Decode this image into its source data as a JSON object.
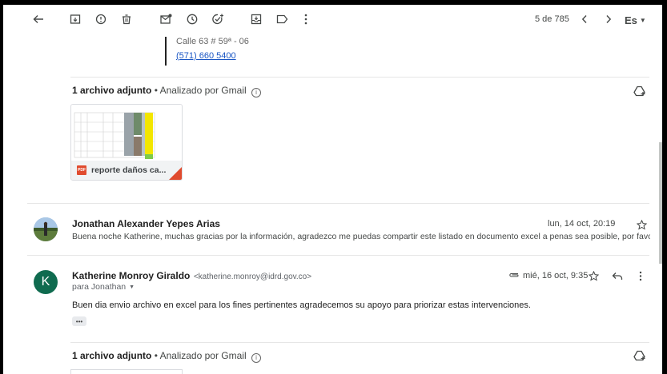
{
  "toolbar": {
    "pagination": "5 de 785",
    "language": "Es",
    "icons": [
      "back-arrow-icon",
      "archive-icon",
      "report-spam-icon",
      "trash-icon",
      "mark-unread-icon",
      "snooze-icon",
      "add-task-icon",
      "move-to-icon",
      "label-icon",
      "more-vert-icon",
      "prev-icon",
      "next-icon",
      "caret-down-icon"
    ]
  },
  "signature": {
    "address": "Calle 63 # 59ª - 06",
    "phone": "(571) 660 5400"
  },
  "attachments_1": {
    "count_label": "1 archivo adjunto",
    "scanned_label": " • Analizado por Gmail",
    "file_name": "reporte daños ca...",
    "file_type": "PDF"
  },
  "message_jonathan": {
    "avatar_initial": "",
    "sender": "Jonathan Alexander Yepes Arias",
    "date": "lun, 14 oct, 20:19",
    "snippet": "Buena noche Katherine, muchas gracias por la información, agradezco me puedas compartir este listado en documento excel a penas sea posible, por favor. ..."
  },
  "message_katherine": {
    "avatar_initial": "K",
    "sender": "Katherine Monroy Giraldo",
    "email": "<katherine.monroy@idrd.gov.co>",
    "to": "para Jonathan",
    "date": "mié, 16 oct, 9:35",
    "body": "Buen dia envio archivo en excel para los fines pertinentes agradecemos su apoyo para priorizar estas intervenciones.",
    "expand_label": "•••"
  },
  "attachments_2": {
    "count_label": "1 archivo adjunto",
    "scanned_label": " • Analizado por Gmail"
  },
  "colors": {
    "avatar_k": "#0f6b4f",
    "link": "#1a56c4",
    "pdf_red": "#e04b2e",
    "thumb_yellow": "#f3e600"
  }
}
